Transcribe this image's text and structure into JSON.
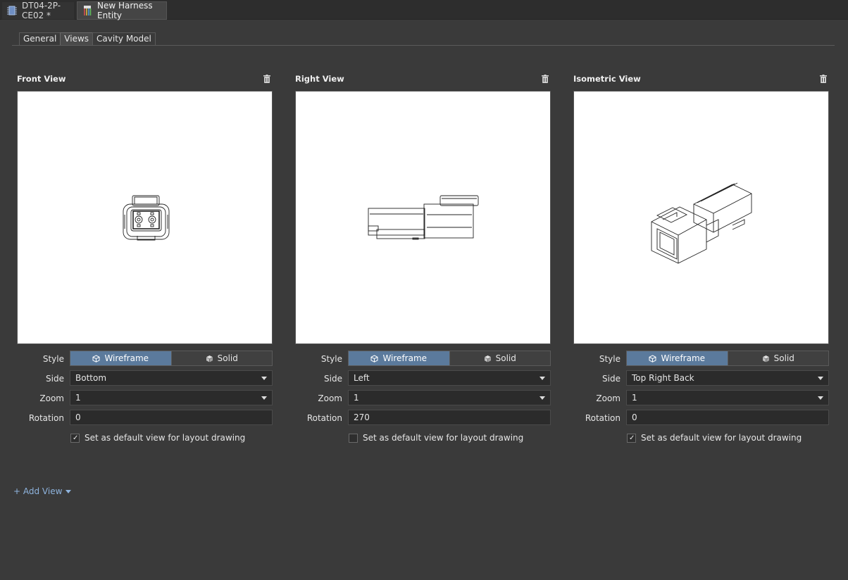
{
  "doc_tabs": [
    {
      "label": "DT04-2P-CE02 *",
      "icon": "chip-icon"
    },
    {
      "label": "New Harness Entity",
      "icon": "harness-icon"
    }
  ],
  "page_tabs": [
    "General",
    "Views",
    "Cavity Model"
  ],
  "active_page_tab": "Views",
  "labels": {
    "style": "Style",
    "side": "Side",
    "zoom": "Zoom",
    "rotation": "Rotation",
    "wireframe": "Wireframe",
    "solid": "Solid",
    "default_view": "Set as default view for layout drawing"
  },
  "views": [
    {
      "title": "Front View",
      "style": "Wireframe",
      "side": "Bottom",
      "zoom": "1",
      "rotation": "0",
      "default": true
    },
    {
      "title": "Right View",
      "style": "Wireframe",
      "side": "Left",
      "zoom": "1",
      "rotation": "270",
      "default": false
    },
    {
      "title": "Isometric View",
      "style": "Wireframe",
      "side": "Top Right Back",
      "zoom": "1",
      "rotation": "0",
      "default": true
    }
  ],
  "add_view_label": "+ Add View",
  "colors": {
    "accent": "#5b7a9c",
    "link": "#8fb4de",
    "background": "#3a3a3a"
  }
}
